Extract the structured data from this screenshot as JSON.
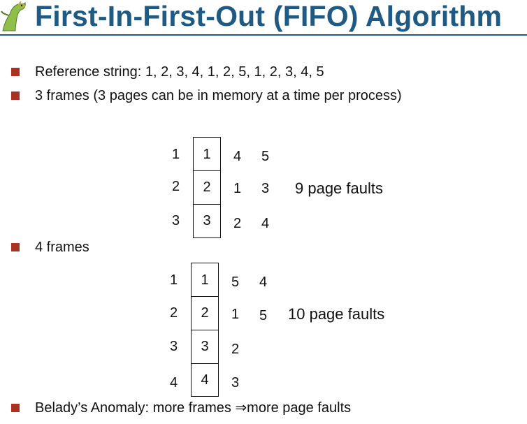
{
  "slide": {
    "title": "First-In-First-Out (FIFO) Algorithm",
    "colors": {
      "title": "#1e5a83",
      "bullet": "#a93222"
    },
    "logo_icon": "dinosaur-logo"
  },
  "bullets": {
    "reference_string": "Reference string: 1, 2, 3, 4, 1, 2, 5, 1, 2, 3, 4, 5",
    "three_frames": "3 frames (3 pages can be in memory at a time per process)",
    "four_frames": "4 frames",
    "belady": "Belady’s Anomaly: more frames ⇒more page faults"
  },
  "diagram3": {
    "row_labels": [
      "1",
      "2",
      "3"
    ],
    "cells": [
      "1",
      "2",
      "3"
    ],
    "col1": [
      "4",
      "1",
      "2"
    ],
    "col2": [
      "5",
      "3",
      "4"
    ],
    "faults": "9 page faults"
  },
  "diagram4": {
    "row_labels": [
      "1",
      "2",
      "3",
      "4"
    ],
    "cells": [
      "1",
      "2",
      "3",
      "4"
    ],
    "col1": [
      "5",
      "1",
      "2",
      "3"
    ],
    "col2": [
      "4",
      "5"
    ],
    "faults": "10 page faults"
  }
}
